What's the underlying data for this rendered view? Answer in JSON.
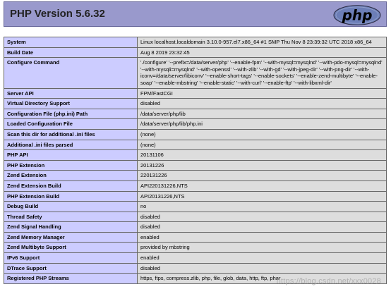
{
  "header": {
    "title": "PHP Version 5.6.32",
    "logo_text": "php"
  },
  "colors": {
    "header_bg": "#9999cc",
    "label_cell_bg": "#ccccff",
    "value_cell_bg": "#dddddd",
    "logo_bg": "#6c7eb7"
  },
  "rows": [
    {
      "label": "System",
      "value": "Linux localhost.localdomain 3.10.0-957.el7.x86_64 #1 SMP Thu Nov 8 23:39:32 UTC 2018 x86_64"
    },
    {
      "label": "Build Date",
      "value": "Aug 8 2019 23:32:45"
    },
    {
      "label": "Configure Command",
      "value": "'./configure' '--prefix=/data/server/php' '--enable-fpm' '--with-mysql=mysqlnd' '--with-pdo-mysql=mysqlnd' '--with-mysqli=mysqlnd' '--with-openssl' '--with-zlib' '--with-gd' '--with-jpeg-dir' '--with-png-dir' '--with-iconv=/data/server/libiconv' '--enable-short-tags' '--enable-sockets' '--enable-zend-multibyte' '--enable-soap' '--enable-mbstring' '--enable-static' '--with-curl' '--enable-ftp' '--with-libxml-dir'"
    },
    {
      "label": "Server API",
      "value": "FPM/FastCGI"
    },
    {
      "label": "Virtual Directory Support",
      "value": "disabled"
    },
    {
      "label": "Configuration File (php.ini) Path",
      "value": "/data/server/php/lib"
    },
    {
      "label": "Loaded Configuration File",
      "value": "/data/server/php/lib/php.ini"
    },
    {
      "label": "Scan this dir for additional .ini files",
      "value": "(none)"
    },
    {
      "label": "Additional .ini files parsed",
      "value": "(none)"
    },
    {
      "label": "PHP API",
      "value": "20131106"
    },
    {
      "label": "PHP Extension",
      "value": "20131226"
    },
    {
      "label": "Zend Extension",
      "value": "220131226"
    },
    {
      "label": "Zend Extension Build",
      "value": "API220131226,NTS"
    },
    {
      "label": "PHP Extension Build",
      "value": "API20131226,NTS"
    },
    {
      "label": "Debug Build",
      "value": "no"
    },
    {
      "label": "Thread Safety",
      "value": "disabled"
    },
    {
      "label": "Zend Signal Handling",
      "value": "disabled"
    },
    {
      "label": "Zend Memory Manager",
      "value": "enabled"
    },
    {
      "label": "Zend Multibyte Support",
      "value": "provided by mbstring"
    },
    {
      "label": "IPv6 Support",
      "value": "enabled"
    },
    {
      "label": "DTrace Support",
      "value": "disabled"
    },
    {
      "label": "Registered PHP Streams",
      "value": "https, ftps, compress.zlib, php, file, glob, data, http, ftp, phar"
    }
  ],
  "watermark": "https://blog.csdn.net/xxx0028"
}
